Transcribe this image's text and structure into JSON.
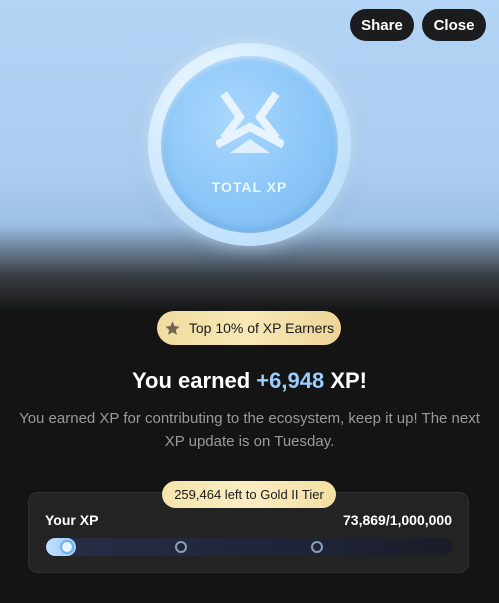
{
  "header": {
    "share_label": "Share",
    "close_label": "Close"
  },
  "coin": {
    "label": "TOTAL XP",
    "icon": "xp-logo-icon"
  },
  "badge": {
    "label": "Top 10% of XP Earners",
    "icon": "star-icon"
  },
  "headline": {
    "prefix": "You earned ",
    "amount": "+6,948",
    "suffix": " XP!"
  },
  "description": "You earned XP for contributing to the ecosystem, keep it up! The next XP update is on Tuesday.",
  "progress": {
    "tooltip": "259,464 left to Gold II Tier",
    "title": "Your XP",
    "value_text": "73,869/1,000,000",
    "current": 73869,
    "max": 1000000
  },
  "colors": {
    "accent": "#9acdfb",
    "badge_gold": "#f7e8b5",
    "background": "#141414"
  }
}
